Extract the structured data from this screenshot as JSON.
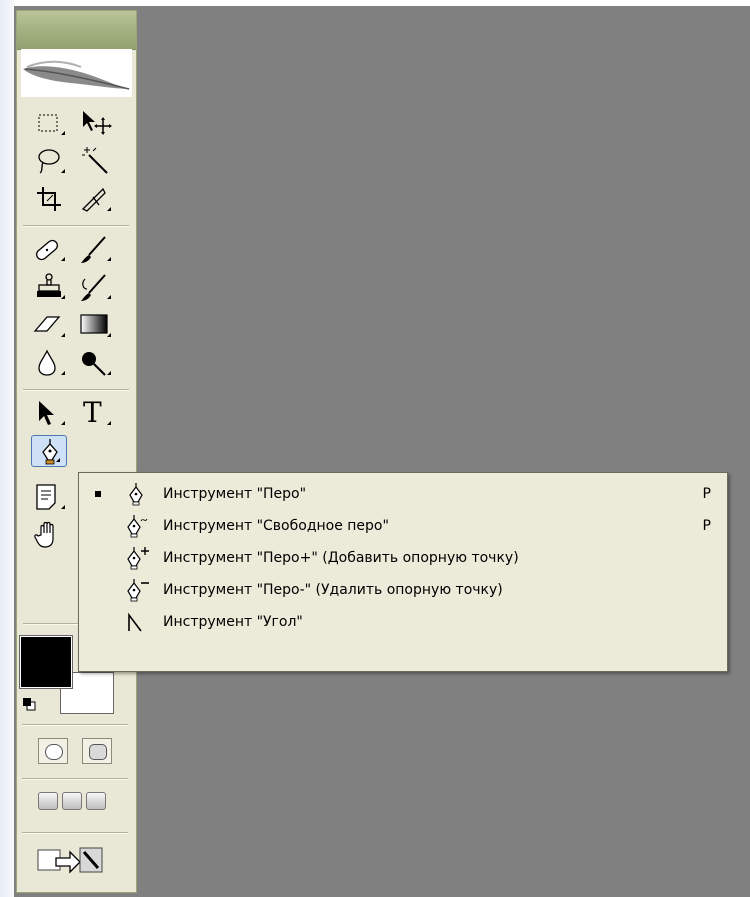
{
  "toolbox": {
    "tools": [
      {
        "id": "marquee",
        "icon": "rectangular-marquee-icon"
      },
      {
        "id": "move",
        "icon": "move-icon"
      },
      {
        "id": "lasso",
        "icon": "lasso-icon"
      },
      {
        "id": "magic-wand",
        "icon": "magic-wand-icon"
      },
      {
        "id": "crop",
        "icon": "crop-icon"
      },
      {
        "id": "slice",
        "icon": "slice-icon"
      },
      {
        "id": "healing",
        "icon": "healing-brush-icon"
      },
      {
        "id": "brush",
        "icon": "brush-icon"
      },
      {
        "id": "clone-stamp",
        "icon": "clone-stamp-icon"
      },
      {
        "id": "history-brush",
        "icon": "history-brush-icon"
      },
      {
        "id": "eraser",
        "icon": "eraser-icon"
      },
      {
        "id": "gradient",
        "icon": "gradient-icon"
      },
      {
        "id": "blur",
        "icon": "blur-icon"
      },
      {
        "id": "dodge",
        "icon": "dodge-icon"
      },
      {
        "id": "path-selection",
        "icon": "path-selection-icon"
      },
      {
        "id": "type",
        "icon": "type-icon",
        "glyph": "T"
      },
      {
        "id": "pen",
        "icon": "pen-icon",
        "active": true
      },
      {
        "id": "notes",
        "icon": "notes-icon"
      },
      {
        "id": "hand",
        "icon": "hand-icon"
      }
    ],
    "colors": {
      "foreground": "#000000",
      "background": "#ffffff"
    }
  },
  "flyout": {
    "items": [
      {
        "label": "Инструмент \"Перо\"",
        "shortcut": "P",
        "checked": true,
        "icon": "pen-icon"
      },
      {
        "label": "Инструмент \"Свободное перо\"",
        "shortcut": "P",
        "checked": false,
        "icon": "freeform-pen-icon"
      },
      {
        "label": "Инструмент \"Перо+\" (Добавить опорную точку)",
        "shortcut": "",
        "checked": false,
        "icon": "add-anchor-point-icon"
      },
      {
        "label": "Инструмент \"Перо-\" (Удалить опорную точку)",
        "shortcut": "",
        "checked": false,
        "icon": "delete-anchor-point-icon"
      },
      {
        "label": "Инструмент \"Угол\"",
        "shortcut": "",
        "checked": false,
        "icon": "convert-point-icon"
      }
    ]
  },
  "theme": {
    "canvas": "#808080",
    "toolbox": "#e9e7d5",
    "titlebar": "#9fae7c",
    "flyout": "#ecead9"
  }
}
